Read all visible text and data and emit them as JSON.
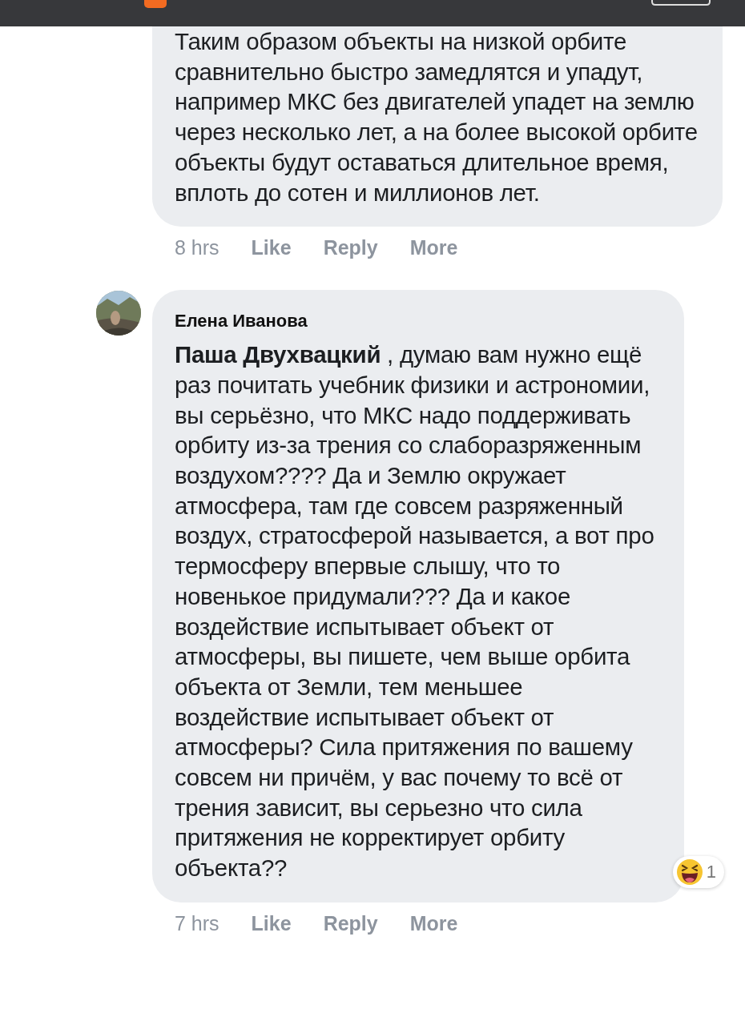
{
  "comments": [
    {
      "text": "Таким образом объекты на низкой орбите сравнительно быстро замедлятся и упадут, например МКС без двигателей упадет на землю через несколько лет, а на более высокой орбите объекты будут оставаться длительное время, вплоть до сотен и миллионов лет.",
      "time": "8 hrs",
      "actions": [
        "Like",
        "Reply",
        "More"
      ],
      "cut_top": true
    },
    {
      "author": "Елена Иванова",
      "text": "**Паша Двухвацкий** , думаю вам нужно ещё раз почитать учебник физики и астрономии, вы серьёзно, что МКС надо поддерживать орбиту из-за трения со слаборазряженным воздухом???? Да и Землю окружает атмосфера, там где совсем разряженный воздух, стратосферой называется, а вот про термосферу впервые слышу, что то новенькое придумали??? Да и какое воздействие испытывает объект от атмосферы, вы пишете, чем выше орбита объекта от Земли, тем меньшее воздействие испытывает объект от атмосферы? Сила притяжения по вашему совсем ни причём, у вас почему то всё от трения зависит, вы серьезно что сила притяжения не корректирует орбиту объекта??",
      "time": "7 hrs",
      "actions": [
        "Like",
        "Reply",
        "More"
      ],
      "cut_top": false,
      "reaction_count": "1"
    }
  ]
}
